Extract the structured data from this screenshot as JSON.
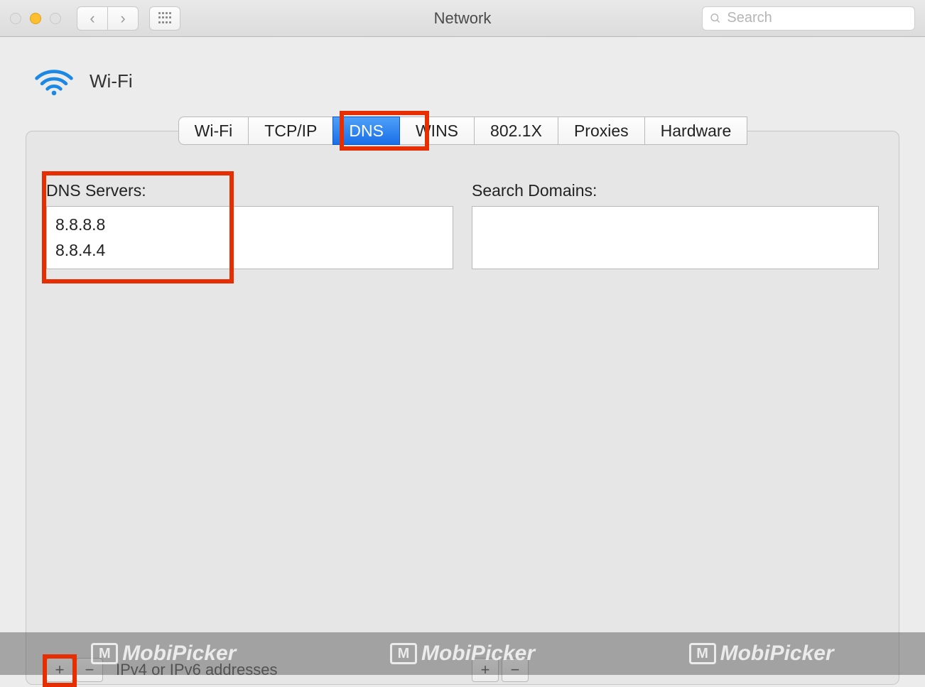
{
  "window": {
    "title": "Network",
    "search_placeholder": "Search"
  },
  "header": {
    "interface_name": "Wi-Fi"
  },
  "tabs": {
    "items": [
      {
        "label": "Wi-Fi"
      },
      {
        "label": "TCP/IP"
      },
      {
        "label": "DNS",
        "active": true
      },
      {
        "label": "WINS"
      },
      {
        "label": "802.1X"
      },
      {
        "label": "Proxies"
      },
      {
        "label": "Hardware"
      }
    ]
  },
  "dns": {
    "servers_label": "DNS Servers:",
    "servers": [
      "8.8.8.8",
      "8.8.4.4"
    ],
    "domains_label": "Search Domains:",
    "domains": [],
    "hint": "IPv4 or IPv6 addresses",
    "add_label": "+",
    "remove_label": "−"
  },
  "watermark": {
    "brand": "MobiPicker"
  },
  "highlight_color": "#e72d02"
}
